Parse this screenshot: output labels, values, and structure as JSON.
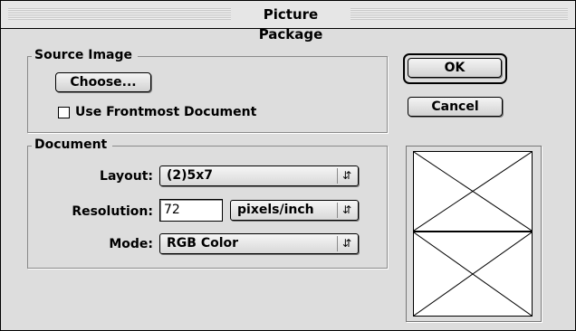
{
  "dialog": {
    "title": "Picture Package"
  },
  "source_image": {
    "group_label": "Source Image",
    "choose_label": "Choose...",
    "use_frontmost_label": "Use Frontmost Document",
    "use_frontmost_checked": false
  },
  "document": {
    "group_label": "Document",
    "layout_label": "Layout:",
    "layout_value": "(2)5x7",
    "resolution_label": "Resolution:",
    "resolution_value": "72",
    "resolution_unit": "pixels/inch",
    "mode_label": "Mode:",
    "mode_value": "RGB Color"
  },
  "buttons": {
    "ok_label": "OK",
    "cancel_label": "Cancel"
  },
  "icons": {
    "select_arrows": "updown-arrows-icon",
    "preview_placeholder": "crossed-box-icon"
  }
}
